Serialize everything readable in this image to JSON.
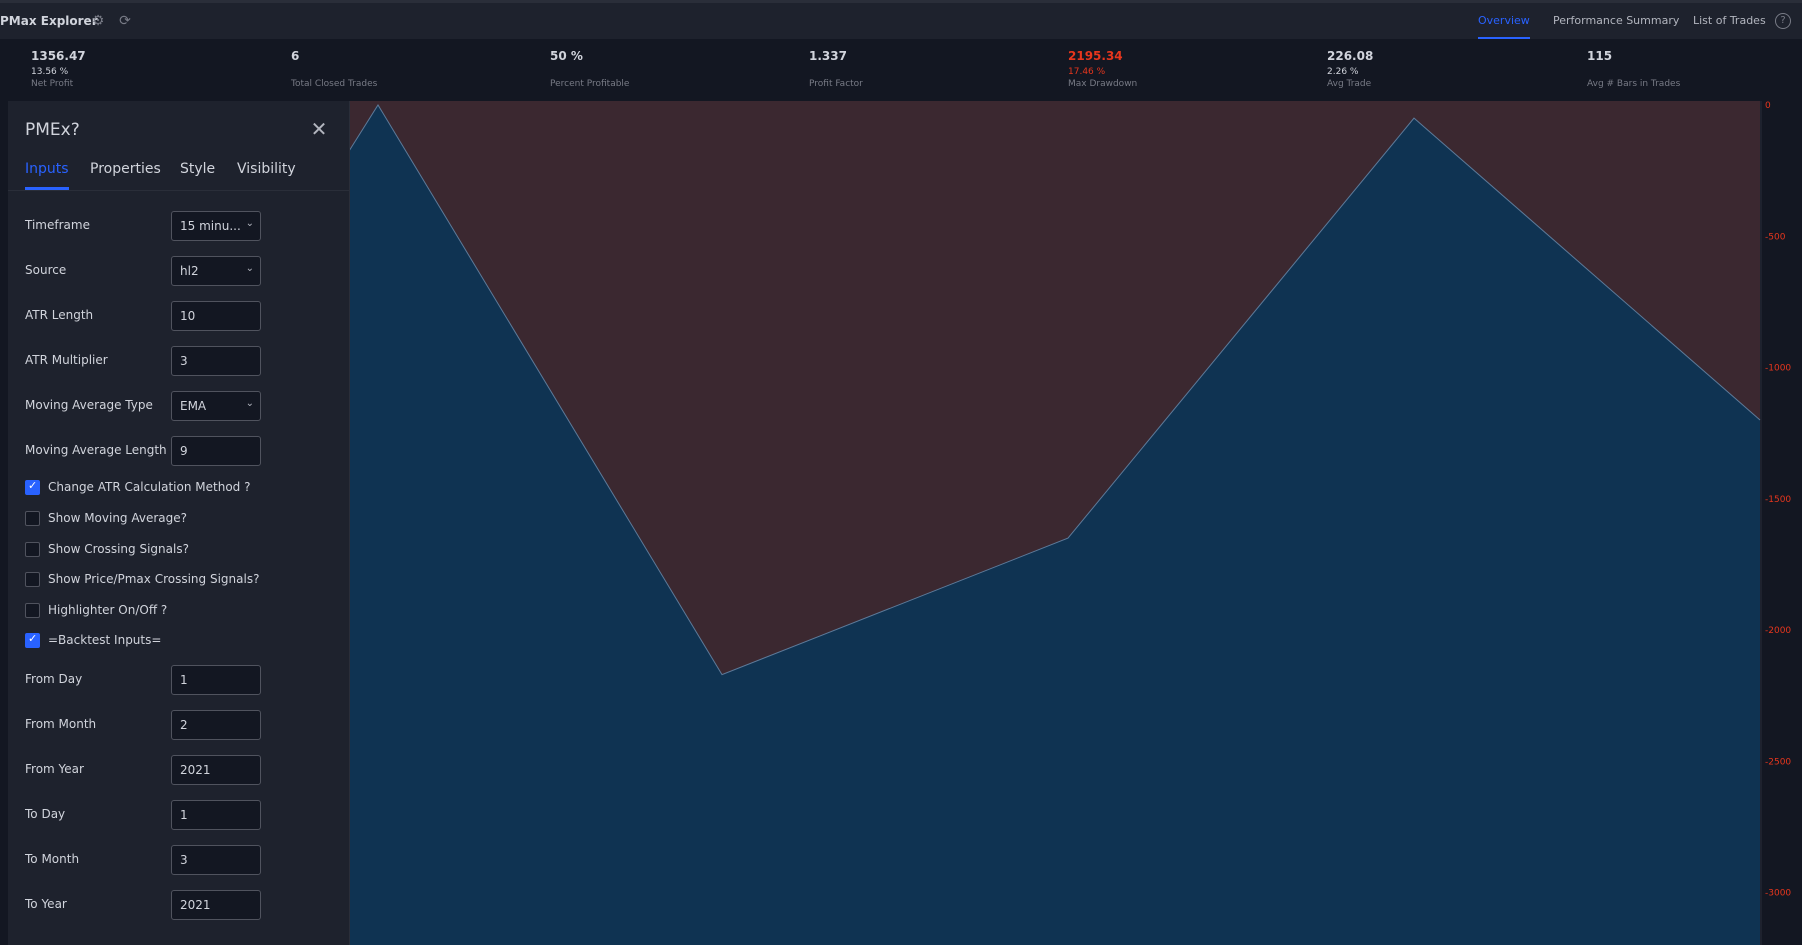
{
  "app": {
    "title": "PMax Explorer"
  },
  "header": {
    "tabs": [
      {
        "label": "Overview",
        "active": true
      },
      {
        "label": "Performance Summary",
        "active": false
      },
      {
        "label": "List of Trades",
        "active": false
      }
    ]
  },
  "stats": [
    {
      "value": "1356.47",
      "sub": "13.56 %",
      "label": "Net Profit"
    },
    {
      "value": "6",
      "sub": "",
      "label": "Total Closed Trades"
    },
    {
      "value": "50 %",
      "sub": "",
      "label": "Percent Profitable"
    },
    {
      "value": "1.337",
      "sub": "",
      "label": "Profit Factor"
    },
    {
      "value": "2195.34",
      "sub": "17.46 %",
      "label": "Max Drawdown",
      "color": "#e6361d"
    },
    {
      "value": "226.08",
      "sub": "2.26 %",
      "label": "Avg Trade"
    },
    {
      "value": "115",
      "sub": "",
      "label": "Avg # Bars in Trades"
    }
  ],
  "dialog": {
    "title": "PMEx?",
    "tabs": [
      {
        "label": "Inputs",
        "active": true
      },
      {
        "label": "Properties",
        "active": false
      },
      {
        "label": "Style",
        "active": false
      },
      {
        "label": "Visibility",
        "active": false
      }
    ],
    "inputs": [
      {
        "label": "Timeframe",
        "value": "15 minu...",
        "kind": "select"
      },
      {
        "label": "Source",
        "value": "hl2",
        "kind": "select"
      },
      {
        "label": "ATR Length",
        "value": "10",
        "kind": "input"
      },
      {
        "label": "ATR Multiplier",
        "value": "3",
        "kind": "input"
      },
      {
        "label": "Moving Average Type",
        "value": "EMA",
        "kind": "select"
      },
      {
        "label": "Moving Average Length",
        "value": "9",
        "kind": "input"
      }
    ],
    "checkboxes": [
      {
        "label": "Change ATR Calculation Method ?",
        "checked": true
      },
      {
        "label": "Show Moving Average?",
        "checked": false
      },
      {
        "label": "Show Crossing Signals?",
        "checked": false
      },
      {
        "label": "Show Price/Pmax Crossing Signals?",
        "checked": false
      },
      {
        "label": "Highlighter On/Off ?",
        "checked": false
      },
      {
        "label": "=Backtest Inputs=",
        "checked": true
      }
    ],
    "backtest": [
      {
        "label": "From Day",
        "value": "1"
      },
      {
        "label": "From Month",
        "value": "2"
      },
      {
        "label": "From Year",
        "value": "2021"
      },
      {
        "label": "To Day",
        "value": "1"
      },
      {
        "label": "To Month",
        "value": "3"
      },
      {
        "label": "To Year",
        "value": "2021"
      }
    ]
  },
  "chart_data": {
    "type": "area",
    "series": [
      {
        "values": [
          -230,
          0,
          -2170,
          -1650,
          -50,
          -1200
        ]
      }
    ],
    "y_ticks": [
      "0",
      "-500",
      "-1000",
      "-1500",
      "-2000",
      "-2500",
      "-3000"
    ],
    "ylim": [
      -3200,
      0
    ],
    "colors": {
      "equity": "#0f3352",
      "drawdown": "#3b2830",
      "line": "#5d7a99",
      "axis_text": "#e6361d"
    }
  }
}
